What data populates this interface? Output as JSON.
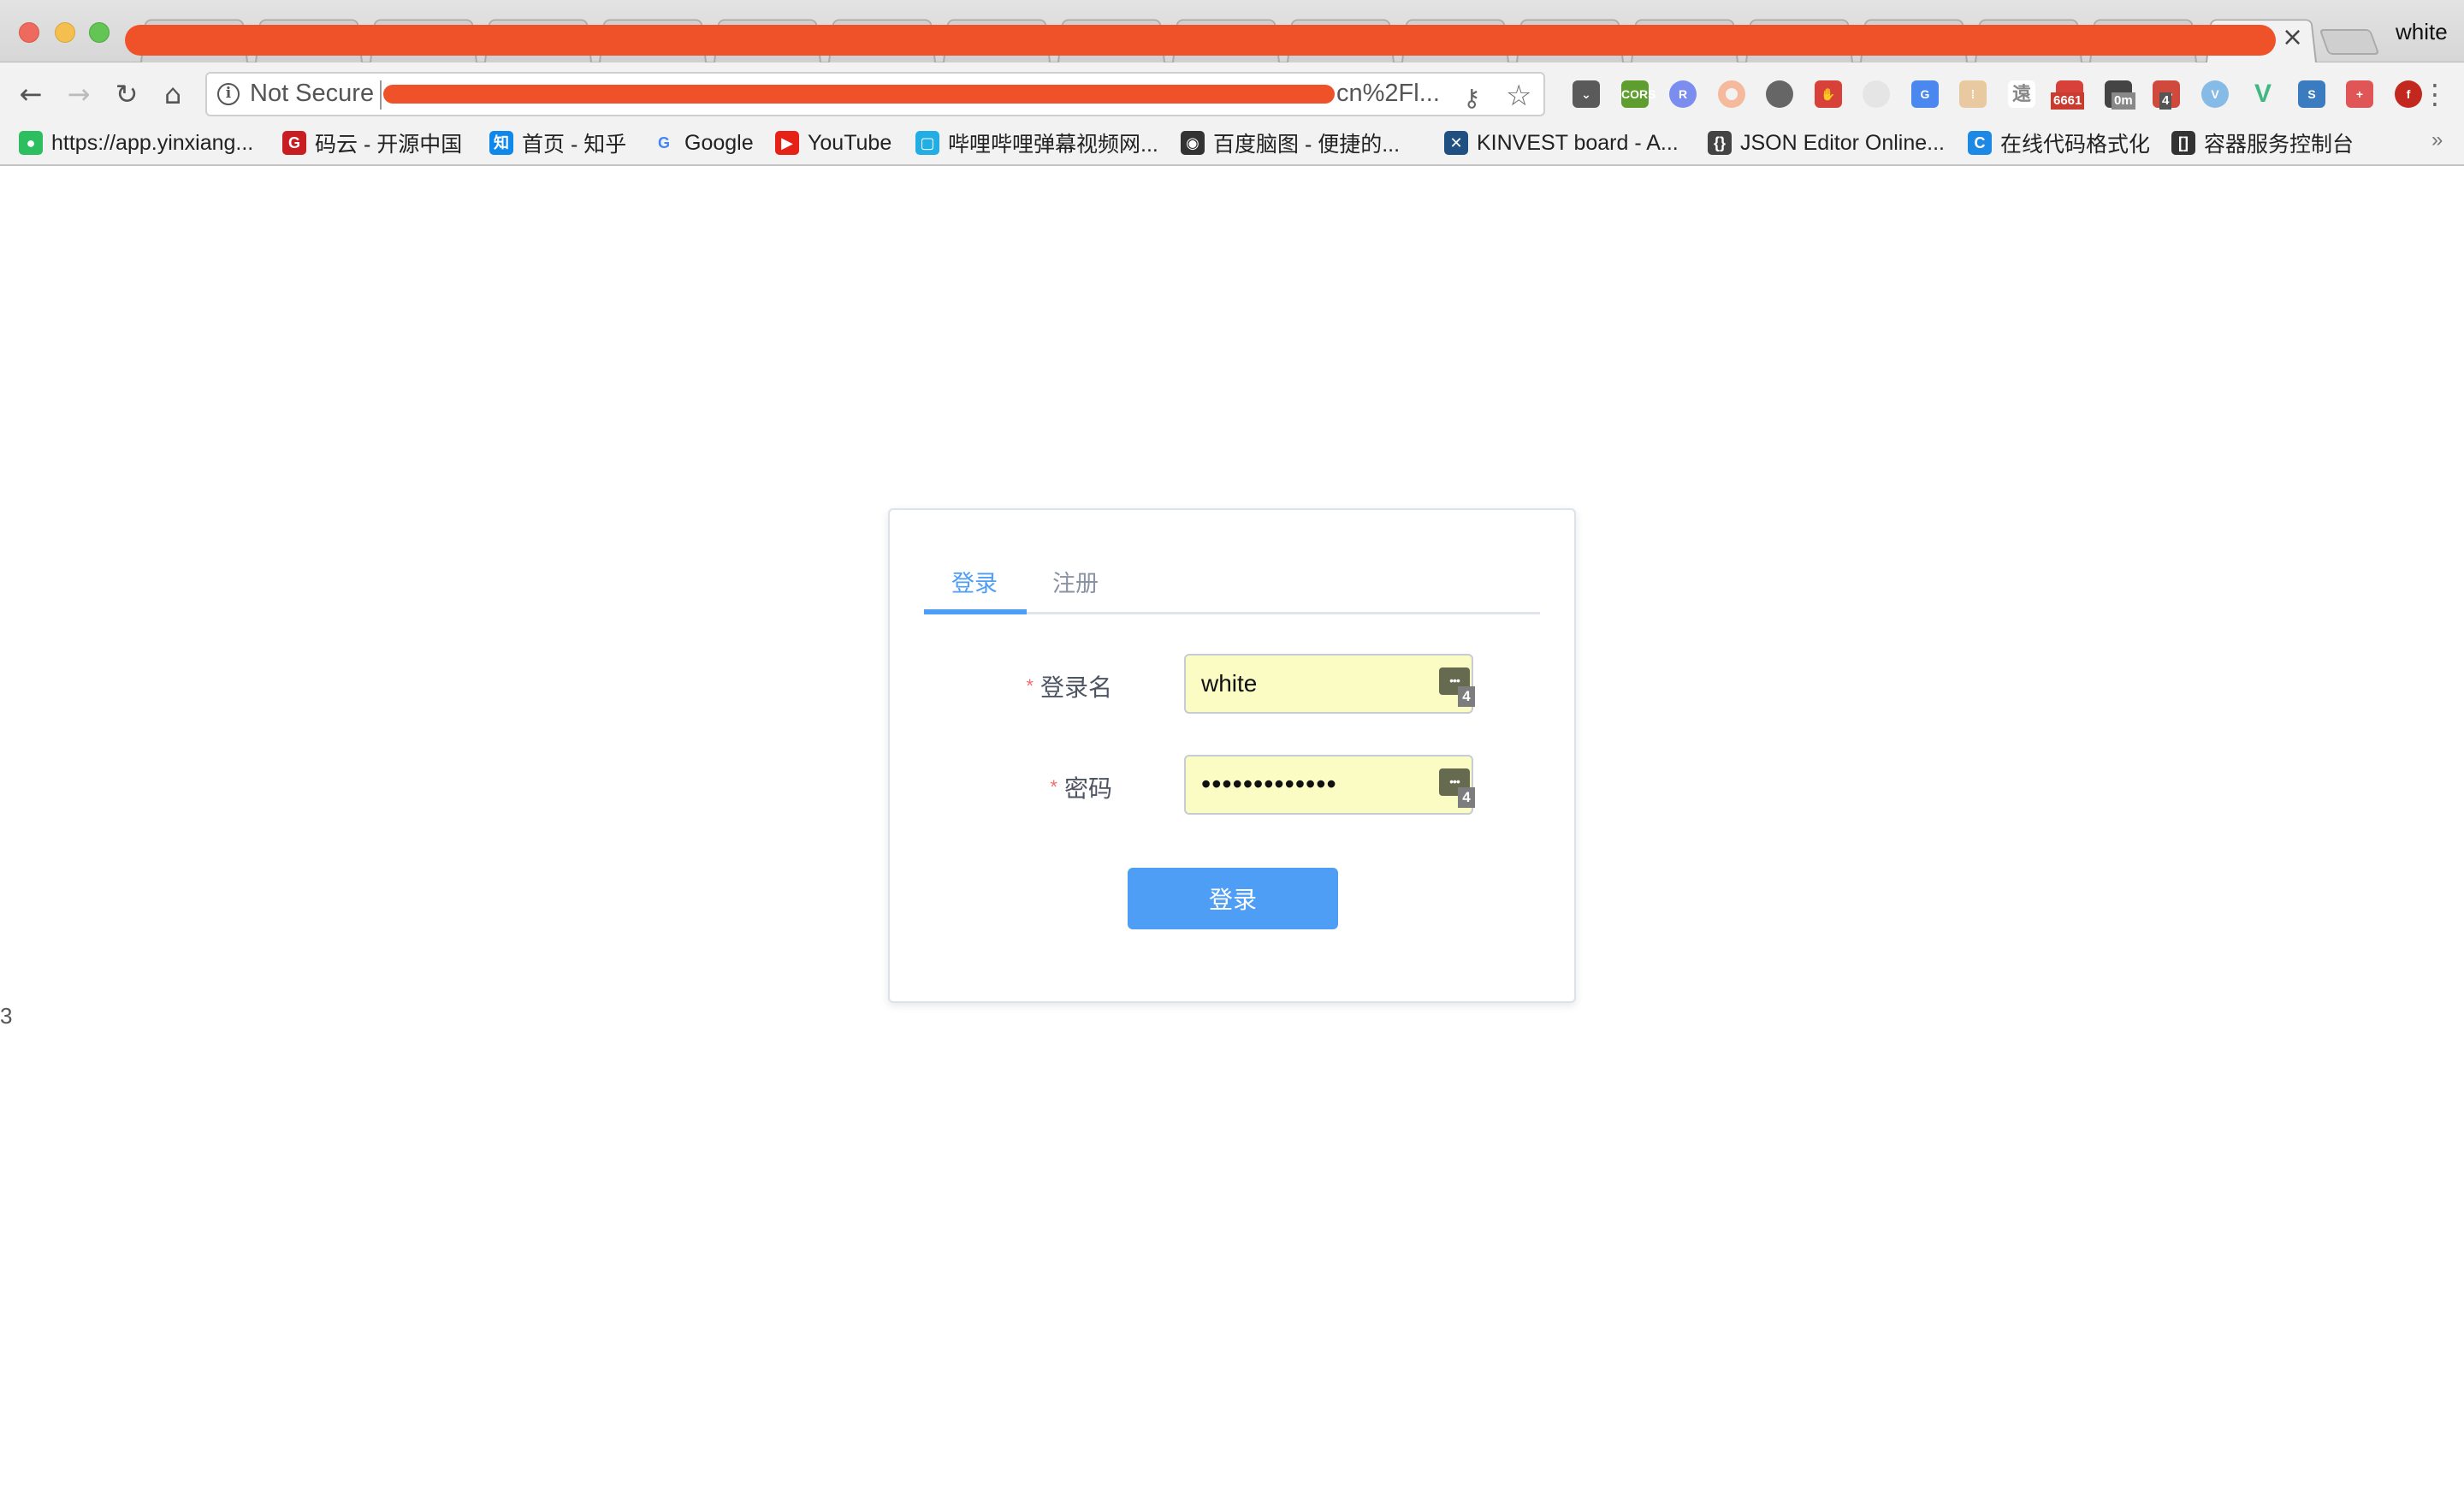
{
  "window": {
    "profile_name": "white",
    "tab_close_glyph": "×"
  },
  "toolbar": {
    "back_glyph": "←",
    "forward_glyph": "→",
    "reload_glyph": "↻",
    "home_glyph": "⌂",
    "security_icon_glyph": "i",
    "security_label": "Not Secure",
    "url_visible_tail": "cn%2Fl...",
    "key_glyph": "⚷",
    "star_glyph": "☆",
    "menu_glyph": "⋮"
  },
  "extensions": [
    {
      "name": "pocket",
      "label": "⌄",
      "color": "#5a5a5a"
    },
    {
      "name": "cors",
      "label": "CORS",
      "color": "#5d9e2e"
    },
    {
      "name": "rsshub",
      "label": "R",
      "color": "#7b8ef0"
    },
    {
      "name": "ring",
      "label": "",
      "color": "#f5b99c"
    },
    {
      "name": "gear-dark",
      "label": "",
      "color": "#666666"
    },
    {
      "name": "adblock",
      "label": "✋",
      "color": "#d8403a"
    },
    {
      "name": "json-viewer",
      "label": "",
      "color": "#e5e5e5"
    },
    {
      "name": "google-translate",
      "label": "G",
      "color": "#4a87ee"
    },
    {
      "name": "outlet",
      "label": "⁞",
      "color": "#e9c9a0"
    },
    {
      "name": "chinese-char",
      "label": "遠",
      "color": "#ffffff"
    },
    {
      "name": "gmail-checker",
      "label": "",
      "color": "#d8403a",
      "badge": "6661",
      "badge_color": "#c93a2f"
    },
    {
      "name": "timer",
      "label": "",
      "color": "#444444",
      "badge": "0m",
      "badge_color": "#888888"
    },
    {
      "name": "lastpass",
      "label": "•••",
      "color": "#cf4a3c",
      "badge": "4",
      "badge_color": "#555555"
    },
    {
      "name": "vimeo-v",
      "label": "V",
      "color": "#86bbe8"
    },
    {
      "name": "vue-devtools",
      "label": "V",
      "color": "#41b883"
    },
    {
      "name": "s-extension",
      "label": "S",
      "color": "#3b7cc1"
    },
    {
      "name": "red-cross",
      "label": "+",
      "color": "#e05555"
    },
    {
      "name": "flash",
      "label": "f",
      "color": "#c2281e"
    }
  ],
  "bookmarks": [
    {
      "label": "https://app.yinxiang...",
      "icon": "evernote",
      "icon_glyph": "●",
      "icon_color": "#2dbe60"
    },
    {
      "label": "码云 - 开源中国",
      "icon": "gitee",
      "icon_glyph": "G",
      "icon_color": "#c71d23"
    },
    {
      "label": "首页 - 知乎",
      "icon": "zhihu",
      "icon_glyph": "知",
      "icon_color": "#0f88eb"
    },
    {
      "label": "Google",
      "icon": "google",
      "icon_glyph": "G",
      "icon_color": "#4285f4"
    },
    {
      "label": "YouTube",
      "icon": "youtube",
      "icon_glyph": "▶",
      "icon_color": "#e62117"
    },
    {
      "label": "哔哩哔哩弹幕视频网...",
      "icon": "bilibili",
      "icon_glyph": "▢",
      "icon_color": "#23ade5"
    },
    {
      "label": "百度脑图 - 便捷的...",
      "icon": "baidu-naotu",
      "icon_glyph": "◉",
      "icon_color": "#333333"
    },
    {
      "label": "KINVEST board - A...",
      "icon": "jira",
      "icon_glyph": "✕",
      "icon_color": "#205081"
    },
    {
      "label": "JSON Editor Online...",
      "icon": "json-editor",
      "icon_glyph": "{}",
      "icon_color": "#444444"
    },
    {
      "label": "在线代码格式化",
      "icon": "code-format",
      "icon_glyph": "C",
      "icon_color": "#1e88e5"
    },
    {
      "label": "容器服务控制台",
      "icon": "container",
      "icon_glyph": "[]",
      "icon_color": "#333333"
    }
  ],
  "bookmarks_overflow": "»",
  "page": {
    "stray_text": "3",
    "login_form": {
      "tabs": [
        {
          "label": "登录",
          "active": true
        },
        {
          "label": "注册",
          "active": false
        }
      ],
      "fields": [
        {
          "label": "登录名",
          "required_mark": "*",
          "value": "white",
          "type": "text"
        },
        {
          "label": "密码",
          "required_mark": "*",
          "value": "•••••••••••••",
          "type": "password"
        }
      ],
      "password_manager_glyph": "•••",
      "password_manager_badge": "4",
      "submit_label": "登录"
    }
  },
  "colors": {
    "accent": "#4f9ef5",
    "required": "#f56c6c",
    "autofill_bg": "#fafcc4",
    "redaction": "#ef5228"
  }
}
